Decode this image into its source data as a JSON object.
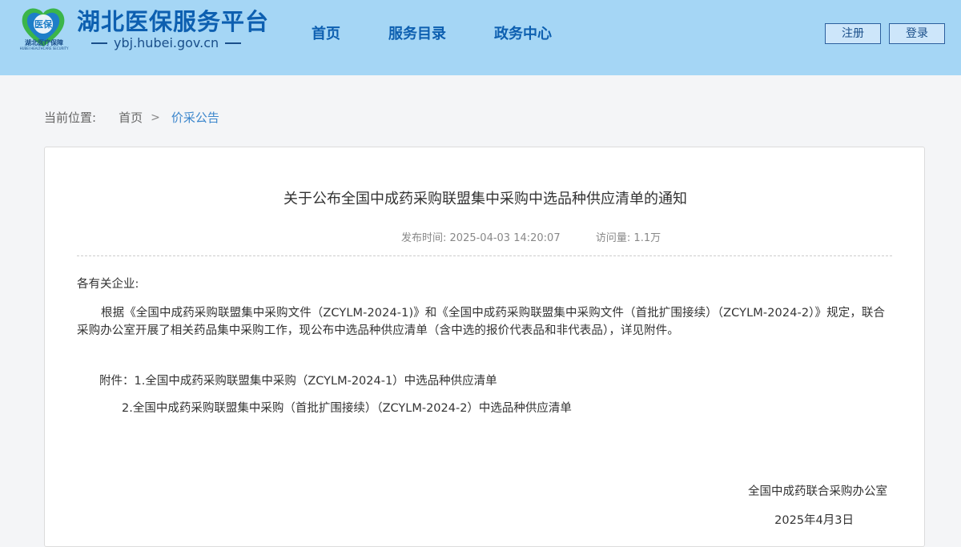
{
  "header": {
    "logo_text": "湖北医疗保障",
    "logo_sub_text": "HUBEI HEALTHCARE SECURITY",
    "site_title": "湖北医保服务平台",
    "site_domain": "ybj.hubei.gov.cn",
    "nav": {
      "home": "首页",
      "catalog": "服务目录",
      "gov_center": "政务中心"
    },
    "buttons": {
      "register": "注册",
      "login": "登录"
    },
    "colors": {
      "header_bg": "#a5d6f5",
      "brand_blue": "#0d5fb0"
    }
  },
  "breadcrumb": {
    "label": "当前位置:",
    "home": "首页",
    "separator": ">",
    "current": "价采公告"
  },
  "article": {
    "title": "关于公布全国中成药采购联盟集中采购中选品种供应清单的通知",
    "publish_label": "发布时间:",
    "publish_time": "2025-04-03 14:20:07",
    "views_label": "访问量:",
    "views": "1.1万",
    "salutation": "各有关企业:",
    "body": "根据《全国中成药采购联盟集中采购文件（ZCYLM-2024-1)》和《全国中成药采购联盟集中采购文件（首批扩围接续）（ZCYLM-2024-2）》规定，联合采购办公室开展了相关药品集中采购工作，现公布中选品种供应清单（含中选的报价代表品和非代表品），详见附件。",
    "attachments": [
      "附件：1.全国中成药采购联盟集中采购（ZCYLM-2024-1）中选品种供应清单",
      "2.全国中成药采购联盟集中采购（首批扩围接续）（ZCYLM-2024-2）中选品种供应清单"
    ],
    "signature": "全国中成药联合采购办公室",
    "date": "2025年4月3日"
  }
}
